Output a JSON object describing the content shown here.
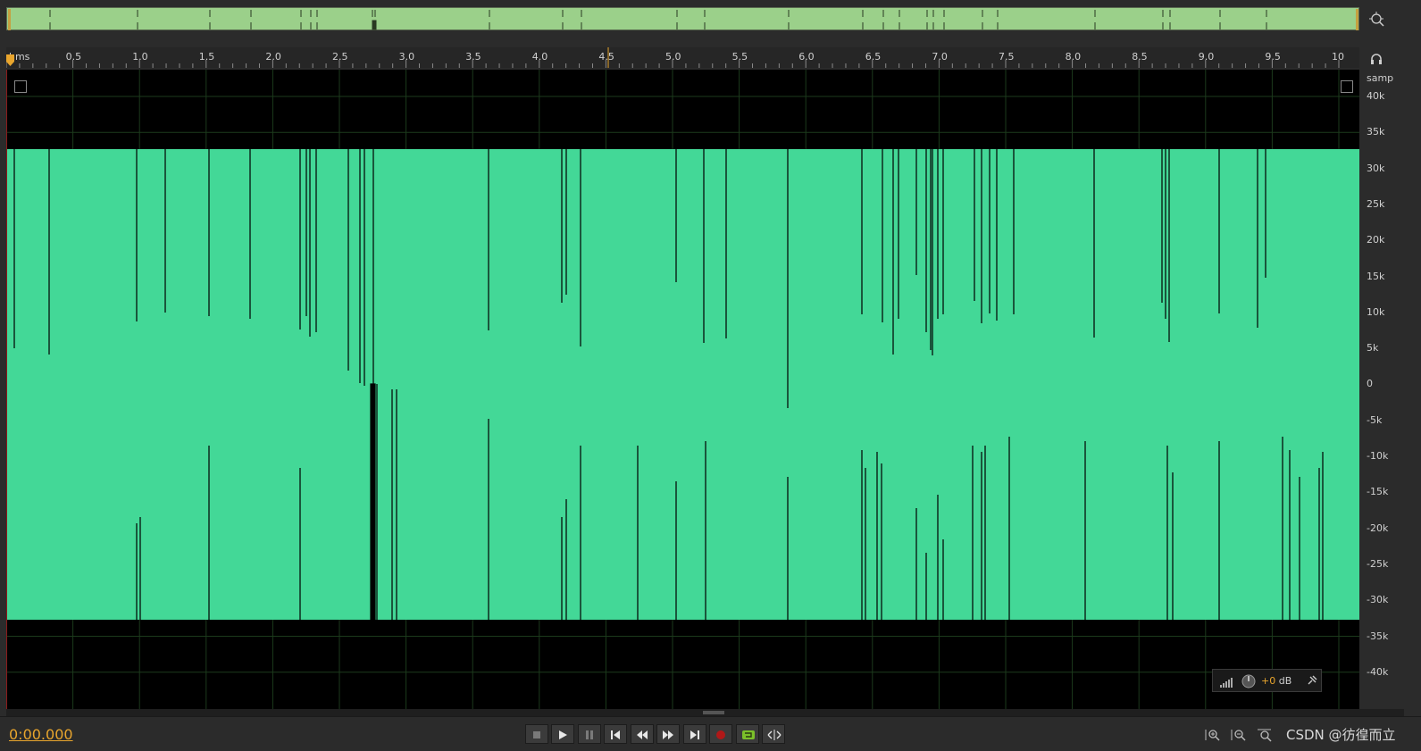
{
  "colors": {
    "waveform": "#43d897",
    "accent": "#e8a52d",
    "background": "#000000",
    "grid": "#1c3a1c",
    "overview": "#9bd08a"
  },
  "ruler": {
    "unit_label": "hms",
    "ticks": [
      "0.5",
      "1.0",
      "1.5",
      "2.0",
      "2.5",
      "3.0",
      "3.5",
      "4.0",
      "4.5",
      "5.0",
      "5.5",
      "6.0",
      "6.5",
      "7.0",
      "7.5",
      "8.0",
      "8.5",
      "9.0",
      "9.5",
      "10"
    ]
  },
  "amplitude_axis": {
    "unit_label": "samp",
    "ticks": [
      "40k",
      "35k",
      "30k",
      "25k",
      "20k",
      "15k",
      "10k",
      "5k",
      "0",
      "-5k",
      "-10k",
      "-15k",
      "-20k",
      "-25k",
      "-30k",
      "-35k",
      "-40k"
    ]
  },
  "hud": {
    "gain_value": "+0",
    "gain_unit": "dB"
  },
  "transport": {
    "timecode": "0:00.000",
    "buttons": [
      {
        "name": "stop-button",
        "icon": "stop-icon"
      },
      {
        "name": "play-button",
        "icon": "play-icon"
      },
      {
        "name": "pause-button",
        "icon": "pause-icon"
      },
      {
        "name": "go-to-start-button",
        "icon": "skip-back-icon"
      },
      {
        "name": "rewind-button",
        "icon": "rewind-icon"
      },
      {
        "name": "fast-forward-button",
        "icon": "fast-forward-icon"
      },
      {
        "name": "go-to-end-button",
        "icon": "skip-forward-icon"
      },
      {
        "name": "record-button",
        "icon": "record-icon"
      },
      {
        "name": "loop-button",
        "icon": "loop-icon"
      },
      {
        "name": "skip-selection-button",
        "icon": "skip-selection-icon"
      }
    ]
  },
  "zoom_buttons": [
    "zoom-in-amplitude-icon",
    "zoom-out-amplitude-icon",
    "zoom-reset-icon"
  ],
  "watermark": "CSDN @彷徨而立"
}
